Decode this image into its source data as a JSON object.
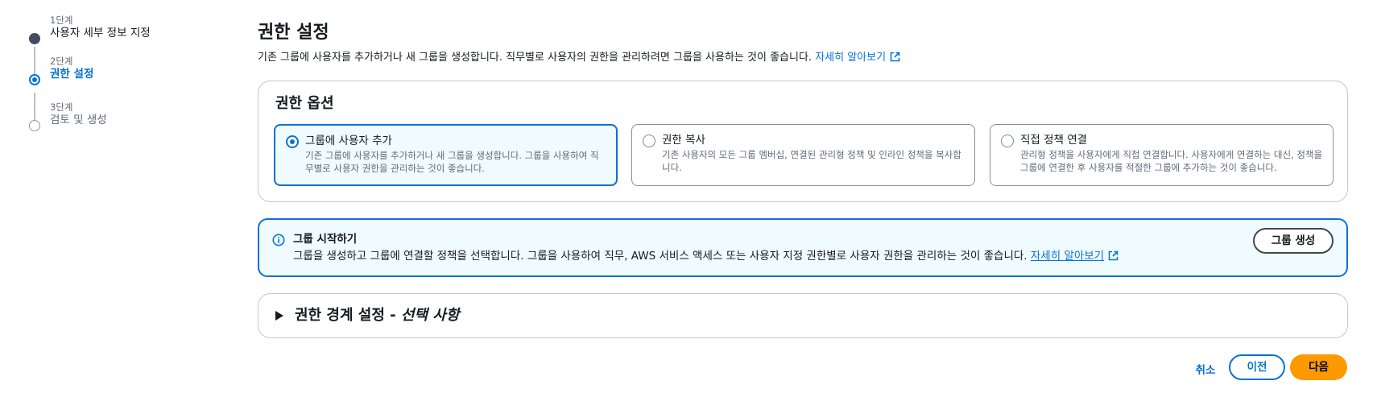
{
  "stepper": {
    "steps": [
      {
        "number": "1단계",
        "label": "사용자 세부 정보 지정",
        "state": "completed"
      },
      {
        "number": "2단계",
        "label": "권한 설정",
        "state": "current"
      },
      {
        "number": "3단계",
        "label": "검토 및 생성",
        "state": "upcoming"
      }
    ]
  },
  "header": {
    "title": "권한 설정",
    "description": "기존 그룹에 사용자를 추가하거나 새 그룹을 생성합니다. 직무별로 사용자의 권한을 관리하려면 그룹을 사용하는 것이 좋습니다.",
    "learn_more": "자세히 알아보기"
  },
  "permission_options": {
    "title": "권한 옵션",
    "options": [
      {
        "title": "그룹에 사용자 추가",
        "description": "기존 그룹에 사용자를 추가하거나 새 그룹을 생성합니다. 그룹을 사용하여 직무별로 사용자 권한을 관리하는 것이 좋습니다.",
        "selected": true
      },
      {
        "title": "권한 복사",
        "description": "기존 사용자의 모든 그룹 멤버십, 연결된 관리형 정책 및 인라인 정책을 복사합니다.",
        "selected": false
      },
      {
        "title": "직접 정책 연결",
        "description": "관리형 정책을 사용자에게 직접 연결합니다. 사용자에게 연결하는 대신, 정책을 그룹에 연결한 후 사용자를 적절한 그룹에 추가하는 것이 좋습니다.",
        "selected": false
      }
    ]
  },
  "info_alert": {
    "title": "그룹 시작하기",
    "description": "그룹을 생성하고 그룹에 연결할 정책을 선택합니다. 그룹을 사용하여 직무, AWS 서비스 액세스 또는 사용자 지정 권한별로 사용자 권한을 관리하는 것이 좋습니다.",
    "learn_more": "자세히 알아보기",
    "button": "그룹 생성"
  },
  "boundary": {
    "title": "권한 경계 설정 - ",
    "optional": "선택 사항"
  },
  "footer": {
    "cancel": "취소",
    "previous": "이전",
    "next": "다음"
  },
  "colors": {
    "accent": "#0972d3",
    "primary_button": "#ff9900",
    "info_background": "#f0fbff"
  }
}
